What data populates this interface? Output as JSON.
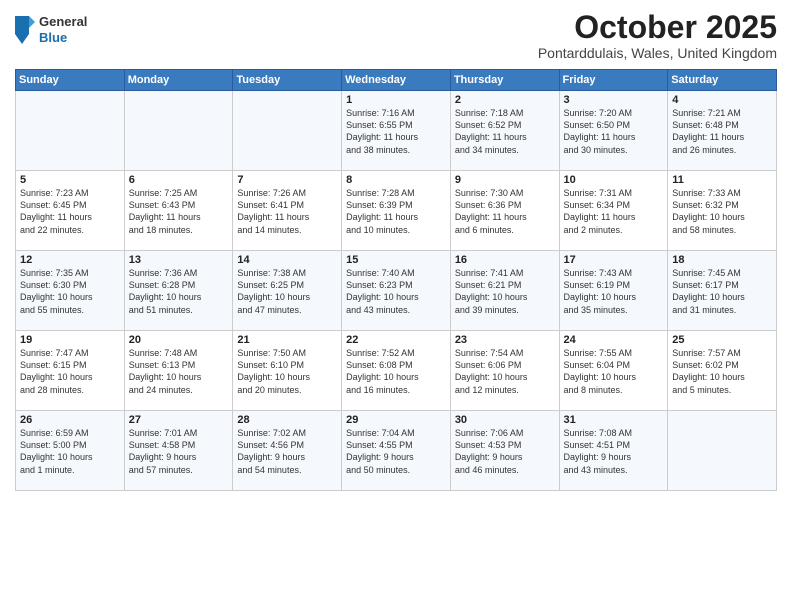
{
  "header": {
    "logo": {
      "general": "General",
      "blue": "Blue"
    },
    "title": "October 2025",
    "location": "Pontarddulais, Wales, United Kingdom"
  },
  "weekdays": [
    "Sunday",
    "Monday",
    "Tuesday",
    "Wednesday",
    "Thursday",
    "Friday",
    "Saturday"
  ],
  "weeks": [
    [
      {
        "day": "",
        "info": ""
      },
      {
        "day": "",
        "info": ""
      },
      {
        "day": "",
        "info": ""
      },
      {
        "day": "1",
        "info": "Sunrise: 7:16 AM\nSunset: 6:55 PM\nDaylight: 11 hours\nand 38 minutes."
      },
      {
        "day": "2",
        "info": "Sunrise: 7:18 AM\nSunset: 6:52 PM\nDaylight: 11 hours\nand 34 minutes."
      },
      {
        "day": "3",
        "info": "Sunrise: 7:20 AM\nSunset: 6:50 PM\nDaylight: 11 hours\nand 30 minutes."
      },
      {
        "day": "4",
        "info": "Sunrise: 7:21 AM\nSunset: 6:48 PM\nDaylight: 11 hours\nand 26 minutes."
      }
    ],
    [
      {
        "day": "5",
        "info": "Sunrise: 7:23 AM\nSunset: 6:45 PM\nDaylight: 11 hours\nand 22 minutes."
      },
      {
        "day": "6",
        "info": "Sunrise: 7:25 AM\nSunset: 6:43 PM\nDaylight: 11 hours\nand 18 minutes."
      },
      {
        "day": "7",
        "info": "Sunrise: 7:26 AM\nSunset: 6:41 PM\nDaylight: 11 hours\nand 14 minutes."
      },
      {
        "day": "8",
        "info": "Sunrise: 7:28 AM\nSunset: 6:39 PM\nDaylight: 11 hours\nand 10 minutes."
      },
      {
        "day": "9",
        "info": "Sunrise: 7:30 AM\nSunset: 6:36 PM\nDaylight: 11 hours\nand 6 minutes."
      },
      {
        "day": "10",
        "info": "Sunrise: 7:31 AM\nSunset: 6:34 PM\nDaylight: 11 hours\nand 2 minutes."
      },
      {
        "day": "11",
        "info": "Sunrise: 7:33 AM\nSunset: 6:32 PM\nDaylight: 10 hours\nand 58 minutes."
      }
    ],
    [
      {
        "day": "12",
        "info": "Sunrise: 7:35 AM\nSunset: 6:30 PM\nDaylight: 10 hours\nand 55 minutes."
      },
      {
        "day": "13",
        "info": "Sunrise: 7:36 AM\nSunset: 6:28 PM\nDaylight: 10 hours\nand 51 minutes."
      },
      {
        "day": "14",
        "info": "Sunrise: 7:38 AM\nSunset: 6:25 PM\nDaylight: 10 hours\nand 47 minutes."
      },
      {
        "day": "15",
        "info": "Sunrise: 7:40 AM\nSunset: 6:23 PM\nDaylight: 10 hours\nand 43 minutes."
      },
      {
        "day": "16",
        "info": "Sunrise: 7:41 AM\nSunset: 6:21 PM\nDaylight: 10 hours\nand 39 minutes."
      },
      {
        "day": "17",
        "info": "Sunrise: 7:43 AM\nSunset: 6:19 PM\nDaylight: 10 hours\nand 35 minutes."
      },
      {
        "day": "18",
        "info": "Sunrise: 7:45 AM\nSunset: 6:17 PM\nDaylight: 10 hours\nand 31 minutes."
      }
    ],
    [
      {
        "day": "19",
        "info": "Sunrise: 7:47 AM\nSunset: 6:15 PM\nDaylight: 10 hours\nand 28 minutes."
      },
      {
        "day": "20",
        "info": "Sunrise: 7:48 AM\nSunset: 6:13 PM\nDaylight: 10 hours\nand 24 minutes."
      },
      {
        "day": "21",
        "info": "Sunrise: 7:50 AM\nSunset: 6:10 PM\nDaylight: 10 hours\nand 20 minutes."
      },
      {
        "day": "22",
        "info": "Sunrise: 7:52 AM\nSunset: 6:08 PM\nDaylight: 10 hours\nand 16 minutes."
      },
      {
        "day": "23",
        "info": "Sunrise: 7:54 AM\nSunset: 6:06 PM\nDaylight: 10 hours\nand 12 minutes."
      },
      {
        "day": "24",
        "info": "Sunrise: 7:55 AM\nSunset: 6:04 PM\nDaylight: 10 hours\nand 8 minutes."
      },
      {
        "day": "25",
        "info": "Sunrise: 7:57 AM\nSunset: 6:02 PM\nDaylight: 10 hours\nand 5 minutes."
      }
    ],
    [
      {
        "day": "26",
        "info": "Sunrise: 6:59 AM\nSunset: 5:00 PM\nDaylight: 10 hours\nand 1 minute."
      },
      {
        "day": "27",
        "info": "Sunrise: 7:01 AM\nSunset: 4:58 PM\nDaylight: 9 hours\nand 57 minutes."
      },
      {
        "day": "28",
        "info": "Sunrise: 7:02 AM\nSunset: 4:56 PM\nDaylight: 9 hours\nand 54 minutes."
      },
      {
        "day": "29",
        "info": "Sunrise: 7:04 AM\nSunset: 4:55 PM\nDaylight: 9 hours\nand 50 minutes."
      },
      {
        "day": "30",
        "info": "Sunrise: 7:06 AM\nSunset: 4:53 PM\nDaylight: 9 hours\nand 46 minutes."
      },
      {
        "day": "31",
        "info": "Sunrise: 7:08 AM\nSunset: 4:51 PM\nDaylight: 9 hours\nand 43 minutes."
      },
      {
        "day": "",
        "info": ""
      }
    ]
  ]
}
